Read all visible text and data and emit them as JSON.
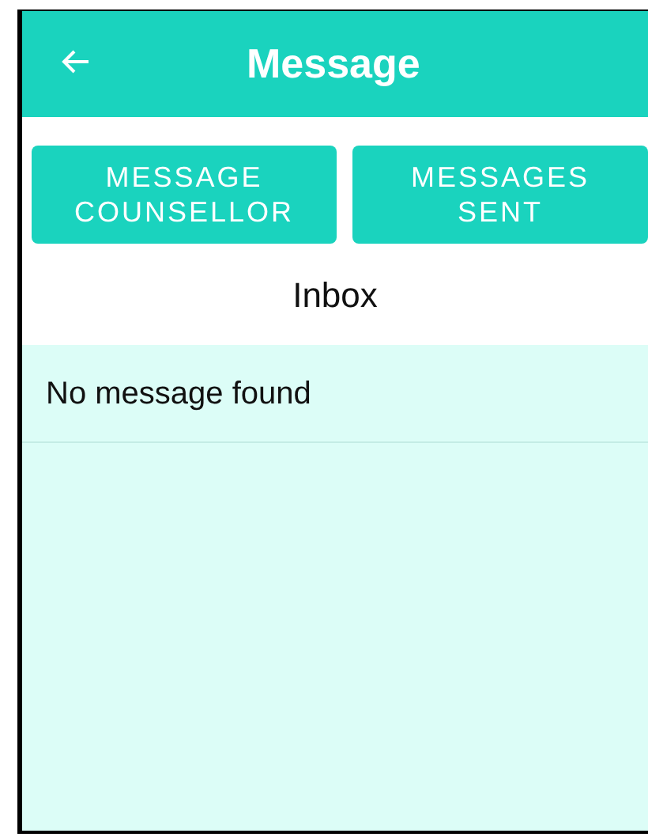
{
  "header": {
    "title": "Message"
  },
  "buttons": [
    {
      "label": "MESSAGE COUNSELLOR"
    },
    {
      "label": "MESSAGES SENT"
    }
  ],
  "section_title": "Inbox",
  "messages_empty": "No message found"
}
